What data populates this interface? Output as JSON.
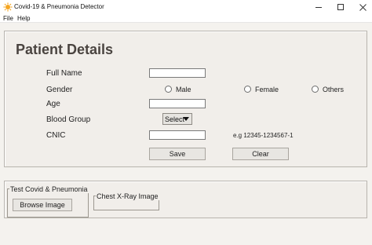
{
  "window": {
    "title": "Covid-19 & Pneumonia Detector",
    "controls": [
      "minimize-icon",
      "maximize-icon",
      "close-icon"
    ]
  },
  "menu": {
    "file": "File",
    "help": "Help"
  },
  "form": {
    "heading": "Patient Details",
    "full_name_label": "Full Name",
    "full_name_value": "",
    "gender_label": "Gender",
    "gender_options": [
      "Male",
      "Female",
      "Others"
    ],
    "gender_selected": null,
    "age_label": "Age",
    "age_value": "",
    "blood_group_label": "Blood Group",
    "blood_group_selected": "Select",
    "cnic_label": "CNIC",
    "cnic_value": "",
    "cnic_hint": "e.g 12345-1234567-1",
    "save_label": "Save",
    "clear_label": "Clear"
  },
  "test": {
    "group_title": "Test Covid & Pneumonia",
    "browse_label": "Browse Image",
    "xray_title": "Chest X-Ray Image"
  },
  "colors": {
    "heading": "#4a4440",
    "panel_bg": "#f1eeea",
    "button_bg": "#e8e6e2",
    "app_icon": "#f5a623"
  }
}
